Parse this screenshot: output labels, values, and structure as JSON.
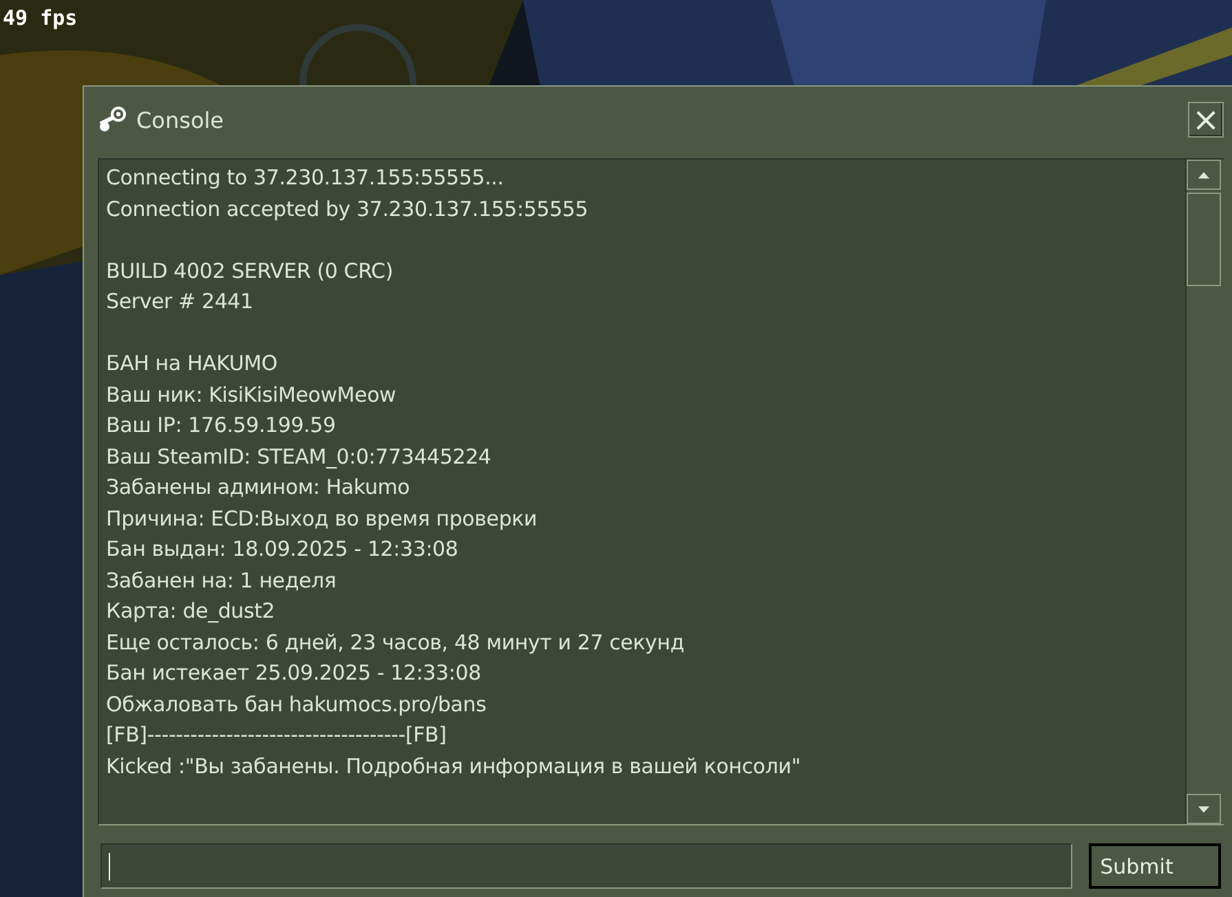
{
  "fps_counter": "49 fps",
  "window": {
    "title": "Console",
    "close": "×"
  },
  "log": {
    "blocks": [
      {
        "lines": [
          "Connecting to 37.230.137.155:55555...",
          "Connection accepted by 37.230.137.155:55555"
        ]
      },
      {
        "lines": [
          "BUILD 4002 SERVER (0 CRC)",
          "Server # 2441"
        ]
      },
      {
        "lines": [
          "БАН на HAKUMO",
          "Ваш ник: KisiKisiMeowMeow",
          "Ваш IP: 176.59.199.59",
          "Ваш SteamID: STEAM_0:0:773445224",
          "Забанены админом: Hakumo",
          "Причина: ECD:Выход во время проверки",
          "Бан выдан: 18.09.2025 - 12:33:08",
          "Забанен на: 1 неделя",
          "Карта: de_dust2",
          "Еще осталось: 6 дней, 23 часов, 48 минут и 27 секунд",
          "Бан истекает 25.09.2025 - 12:33:08",
          "Обжаловать бан hakumocs.pro/bans",
          "[FB]------------------------------------[FB]",
          "Kicked :\"Вы забанены. Подробная информация в вашей консоли\""
        ]
      }
    ]
  },
  "submit_button": "Submit"
}
